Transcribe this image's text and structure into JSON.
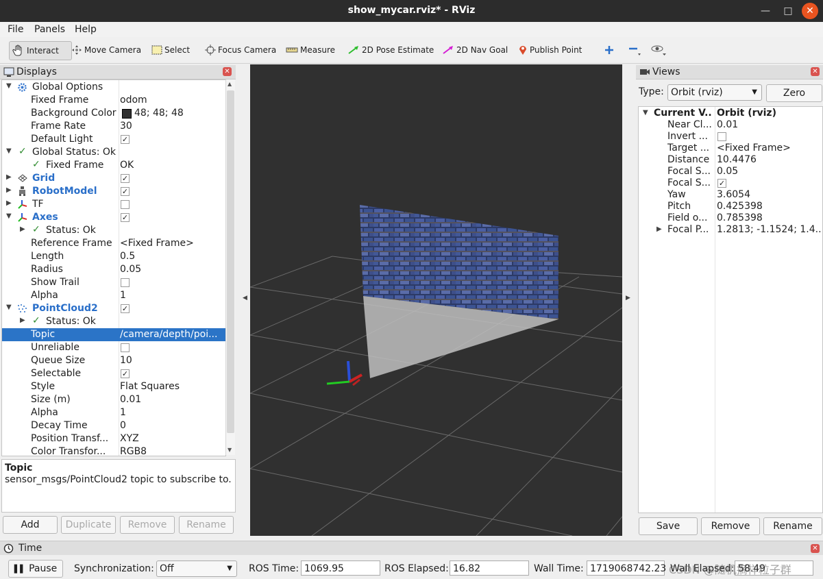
{
  "window": {
    "title": "show_mycar.rviz* - RViz",
    "minimize": "—",
    "maximize": "□",
    "close": "✕"
  },
  "menu": [
    "File",
    "Panels",
    "Help"
  ],
  "toolbar": [
    {
      "name": "interact",
      "label": "Interact",
      "icon": "hand-icon"
    },
    {
      "name": "move-camera",
      "label": "Move Camera",
      "icon": "move-camera-icon"
    },
    {
      "name": "select",
      "label": "Select",
      "icon": "select-box-icon"
    },
    {
      "name": "focus-camera",
      "label": "Focus Camera",
      "icon": "crosshair-icon"
    },
    {
      "name": "measure",
      "label": "Measure",
      "icon": "ruler-icon"
    },
    {
      "name": "2d-pose-estimate",
      "label": "2D Pose Estimate",
      "icon": "green-arrow-icon"
    },
    {
      "name": "2d-nav-goal",
      "label": "2D Nav Goal",
      "icon": "magenta-arrow-icon"
    },
    {
      "name": "publish-point",
      "label": "Publish Point",
      "icon": "map-pin-icon"
    }
  ],
  "displays": {
    "title": "Displays",
    "rows": [
      {
        "label": "Global Options",
        "value": ""
      },
      {
        "label": "Fixed Frame",
        "value": "odom"
      },
      {
        "label": "Background Color",
        "value": "48; 48; 48"
      },
      {
        "label": "Frame Rate",
        "value": "30"
      },
      {
        "label": "Default Light",
        "value": ""
      },
      {
        "label": "Global Status: Ok",
        "value": ""
      },
      {
        "label": "Fixed Frame",
        "value": "OK"
      },
      {
        "label": "Grid",
        "value": ""
      },
      {
        "label": "RobotModel",
        "value": ""
      },
      {
        "label": "TF",
        "value": ""
      },
      {
        "label": "Axes",
        "value": ""
      },
      {
        "label": "Status: Ok",
        "value": ""
      },
      {
        "label": "Reference Frame",
        "value": "<Fixed Frame>"
      },
      {
        "label": "Length",
        "value": "0.5"
      },
      {
        "label": "Radius",
        "value": "0.05"
      },
      {
        "label": "Show Trail",
        "value": ""
      },
      {
        "label": "Alpha",
        "value": "1"
      },
      {
        "label": "PointCloud2",
        "value": ""
      },
      {
        "label": "Status: Ok",
        "value": ""
      },
      {
        "label": "Topic",
        "value": "/camera/depth/poi..."
      },
      {
        "label": "Unreliable",
        "value": ""
      },
      {
        "label": "Queue Size",
        "value": "10"
      },
      {
        "label": "Selectable",
        "value": ""
      },
      {
        "label": "Style",
        "value": "Flat Squares"
      },
      {
        "label": "Size (m)",
        "value": "0.01"
      },
      {
        "label": "Alpha",
        "value": "1"
      },
      {
        "label": "Decay Time",
        "value": "0"
      },
      {
        "label": "Position Transf...",
        "value": "XYZ"
      },
      {
        "label": "Color Transfor...",
        "value": "RGB8"
      }
    ],
    "description_title": "Topic",
    "description_text": "sensor_msgs/PointCloud2 topic to subscribe to.",
    "buttons": {
      "add": "Add",
      "duplicate": "Duplicate",
      "remove": "Remove",
      "rename": "Rename"
    }
  },
  "views": {
    "title": "Views",
    "type_label": "Type:",
    "type_value": "Orbit (rviz)",
    "zero": "Zero",
    "header": {
      "label": "Current V...",
      "value": "Orbit (rviz)"
    },
    "rows": [
      {
        "label": "Near Cl...",
        "value": "0.01"
      },
      {
        "label": "Invert ...",
        "value": ""
      },
      {
        "label": "Target ...",
        "value": "<Fixed Frame>"
      },
      {
        "label": "Distance",
        "value": "10.4476"
      },
      {
        "label": "Focal S...",
        "value": "0.05"
      },
      {
        "label": "Focal S...",
        "value": ""
      },
      {
        "label": "Yaw",
        "value": "3.6054"
      },
      {
        "label": "Pitch",
        "value": "0.425398"
      },
      {
        "label": "Field o...",
        "value": "0.785398"
      },
      {
        "label": "Focal P...",
        "value": "1.2813; -1.1524; 1.4..."
      }
    ],
    "buttons": {
      "save": "Save",
      "remove": "Remove",
      "rename": "Rename"
    }
  },
  "time": {
    "title": "Time",
    "pause": "Pause",
    "sync_label": "Synchronization:",
    "sync_value": "Off",
    "ros_time_label": "ROS Time:",
    "ros_time": "1069.95",
    "ros_elapsed_label": "ROS Elapsed:",
    "ros_elapsed": "16.82",
    "wall_time_label": "Wall Time:",
    "wall_time": "1719068742.23",
    "wall_elapsed_label": "Wall Elapsed:",
    "wall_elapsed": "58.49"
  },
  "watermark": "CSDN @随机摘样粒子群",
  "colors": {
    "background": "#303030",
    "selection": "#2b74c7",
    "accent_blue": "#2a6fc9"
  }
}
